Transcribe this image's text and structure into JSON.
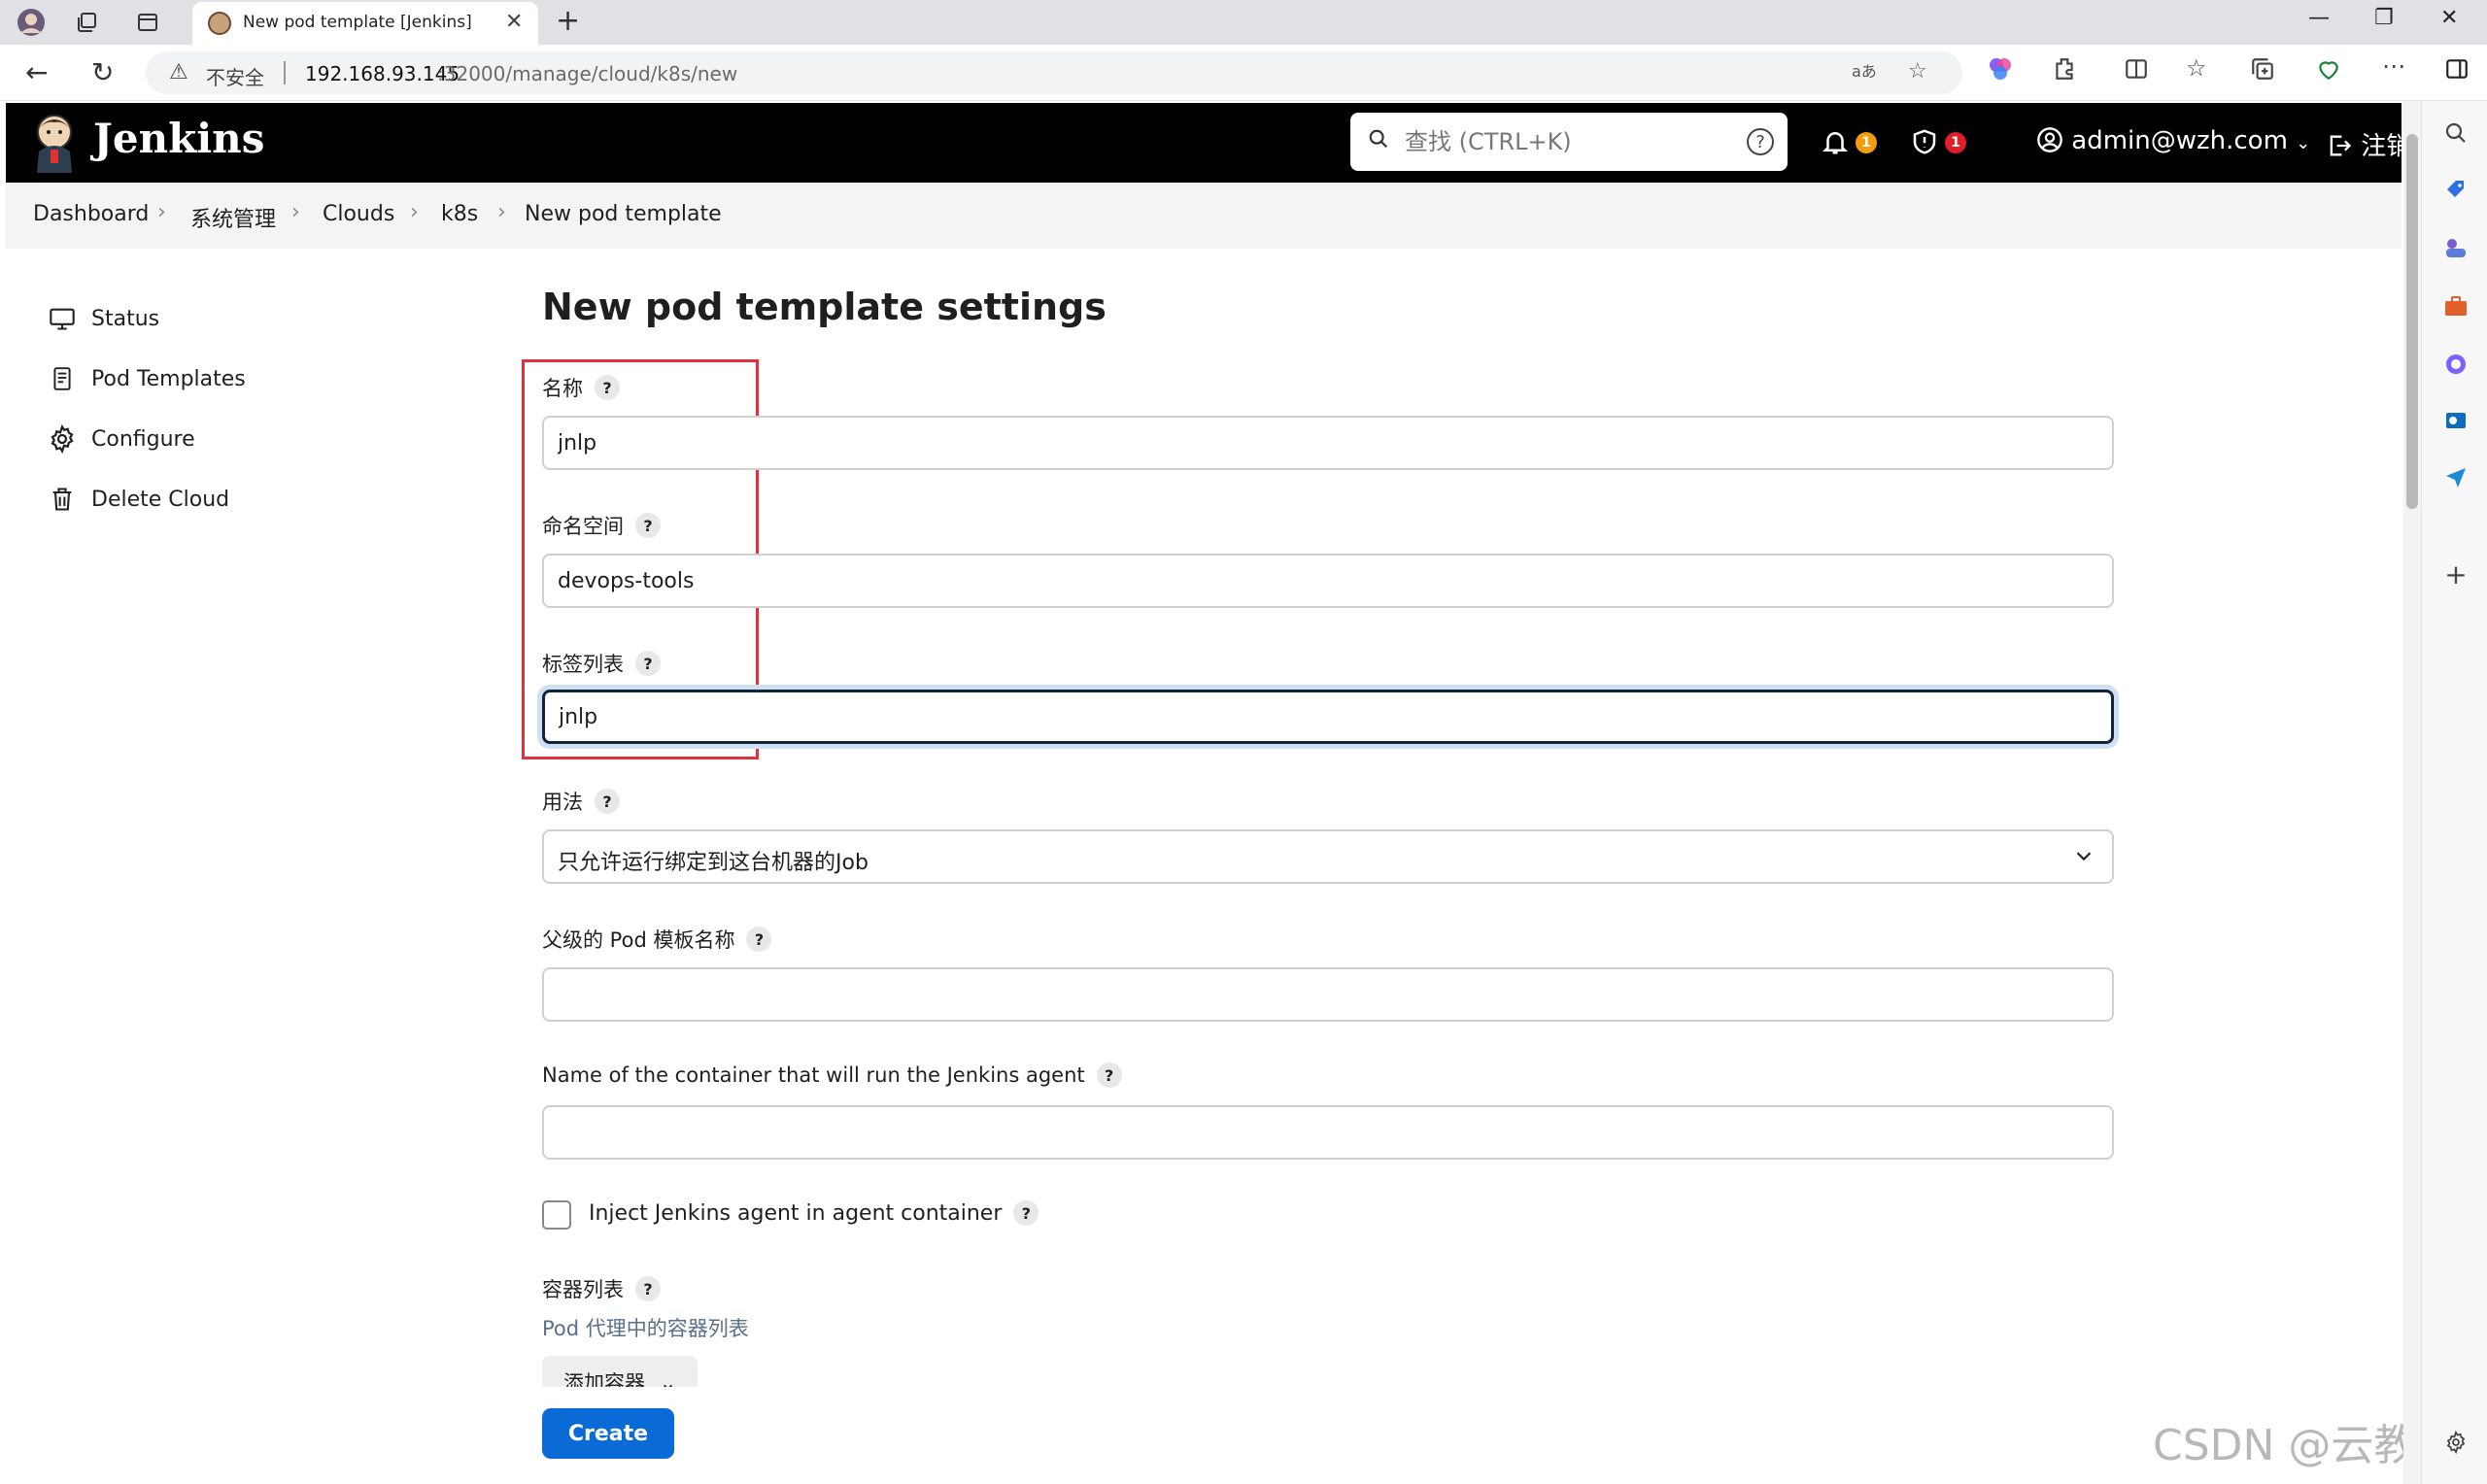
{
  "browser": {
    "tab_title": "New pod template [Jenkins]",
    "insecure_label": "不安全",
    "url_host": "192.168.93.145",
    "url_path": ":32000/manage/cloud/k8s/new"
  },
  "header": {
    "brand": "Jenkins",
    "search_placeholder": "查找 (CTRL+K)",
    "search_help": "?",
    "notifications_count": "1",
    "security_count": "1",
    "user": "admin@wzh.com",
    "logout": "注销"
  },
  "breadcrumb": [
    "Dashboard",
    "系统管理",
    "Clouds",
    "k8s",
    "New pod template"
  ],
  "sidebar": {
    "items": [
      {
        "label": "Status",
        "icon": "monitor-icon"
      },
      {
        "label": "Pod Templates",
        "icon": "document-icon"
      },
      {
        "label": "Configure",
        "icon": "gear-icon"
      },
      {
        "label": "Delete Cloud",
        "icon": "trash-icon"
      }
    ]
  },
  "form": {
    "title": "New pod template settings",
    "help": "?",
    "name_label": "名称",
    "name_value": "jnlp",
    "namespace_label": "命名空间",
    "namespace_value": "devops-tools",
    "labels_label": "标签列表",
    "labels_value": "jnlp",
    "usage_label": "用法",
    "usage_value": "只允许运行绑定到这台机器的Job",
    "parent_label": "父级的 Pod 模板名称",
    "parent_value": "",
    "container_name_label": "Name of the container that will run the Jenkins agent",
    "container_name_value": "",
    "inject_label": "Inject Jenkins agent in agent container",
    "inject_checked": false,
    "containers_label": "容器列表",
    "containers_desc": "Pod 代理中的容器列表",
    "add_container": "添加容器",
    "create": "Create"
  },
  "watermark": "CSDN @云教员",
  "colors": {
    "header_bg": "#000000",
    "primary": "#0b6bd6",
    "highlight_box": "#e0323a",
    "notification_badge": "#f59e0b",
    "security_badge": "#e11d2a"
  }
}
